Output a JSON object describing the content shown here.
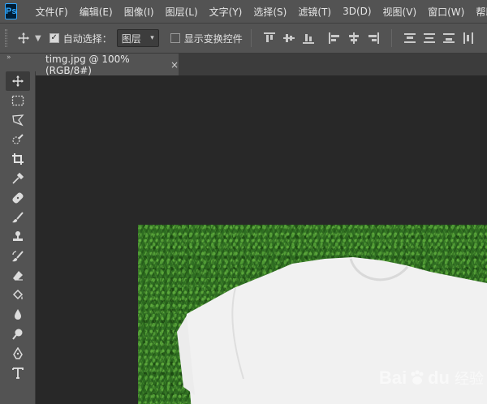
{
  "app": {
    "logo": "Ps"
  },
  "menu": [
    "文件(F)",
    "编辑(E)",
    "图像(I)",
    "图层(L)",
    "文字(Y)",
    "选择(S)",
    "滤镜(T)",
    "3D(D)",
    "视图(V)",
    "窗口(W)",
    "帮助"
  ],
  "options": {
    "auto_select_label": "自动选择：",
    "auto_select_checked": true,
    "auto_select_target": "图层",
    "show_transform_label": "显示变换控件",
    "show_transform_checked": false
  },
  "panel": {
    "collapse_glyph": "»"
  },
  "document": {
    "tab_title": "timg.jpg @ 100%(RGB/8#)",
    "close_glyph": "×"
  },
  "tools": [
    {
      "name": "move-tool",
      "icon": "move-icon",
      "active": true
    },
    {
      "name": "marquee-tool",
      "icon": "rect-marquee-icon"
    },
    {
      "name": "lasso-tool",
      "icon": "polygon-lasso-icon"
    },
    {
      "name": "quick-select-tool",
      "icon": "quick-select-icon"
    },
    {
      "name": "crop-tool",
      "icon": "crop-icon"
    },
    {
      "name": "eyedropper-tool",
      "icon": "eyedropper-icon"
    },
    {
      "name": "healing-tool",
      "icon": "bandage-icon"
    },
    {
      "name": "brush-tool",
      "icon": "brush-icon"
    },
    {
      "name": "stamp-tool",
      "icon": "stamp-icon"
    },
    {
      "name": "history-brush-tool",
      "icon": "history-brush-icon"
    },
    {
      "name": "eraser-tool",
      "icon": "eraser-icon"
    },
    {
      "name": "paint-bucket-tool",
      "icon": "paint-bucket-icon"
    },
    {
      "name": "blur-tool",
      "icon": "drop-icon"
    },
    {
      "name": "dodge-tool",
      "icon": "dodge-icon"
    },
    {
      "name": "pen-tool",
      "icon": "pen-icon"
    },
    {
      "name": "type-tool",
      "icon": "type-icon"
    }
  ],
  "watermark": {
    "brand_left": "Bai",
    "brand_right": "du",
    "suffix": "经验"
  },
  "colors": {
    "ui_bg": "#535353",
    "canvas_bg": "#282828",
    "grass": "#2f6e22",
    "shirt": "#f2f2f2"
  }
}
